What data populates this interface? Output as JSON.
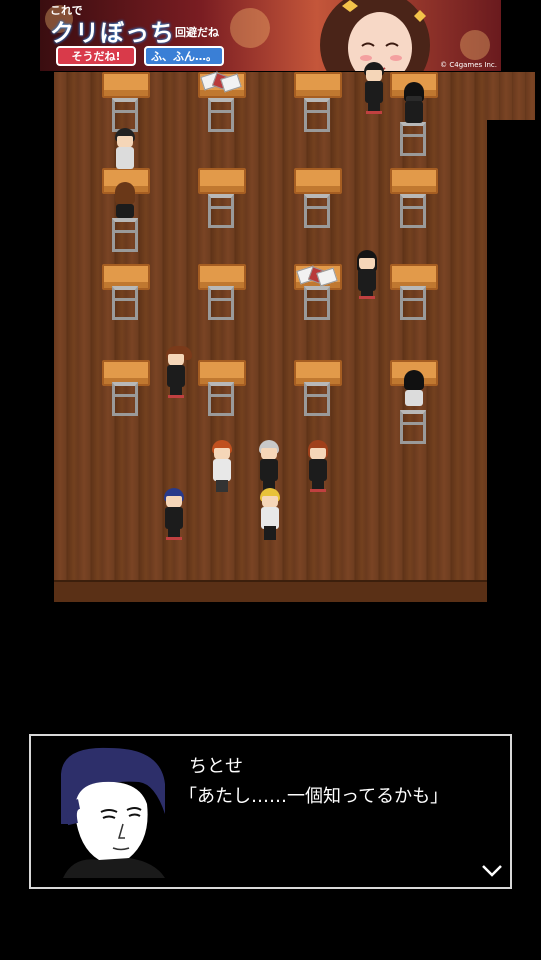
{
  "ad": {
    "small": "これで",
    "big": "クリぼっち",
    "sub": "回避だね",
    "btn_yes": "そうだね!",
    "btn_hmm": "ふ、ふん…。",
    "copyright": "© C4games Inc."
  },
  "dialog": {
    "speaker": "ちとせ",
    "line": "「あたし……一個知ってるかも」",
    "next_icon": "chevron-down-icon"
  },
  "colors": {
    "floor": "#6a3a1e",
    "desk": "#e29a4a",
    "dialog_border": "#d8d8d8"
  }
}
